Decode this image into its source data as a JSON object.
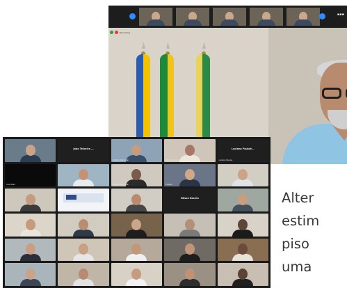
{
  "top_call": {
    "recording_label": "Recording",
    "strip_tile_captions": [
      "",
      "",
      "",
      "",
      ""
    ],
    "strip_more": "▪▪▪"
  },
  "gallery": {
    "tiles": [
      {
        "kind": "person",
        "bg": "#6a7c8a",
        "head": "#caa389",
        "torso": "#2c3e52",
        "caption": ""
      },
      {
        "kind": "name",
        "bg": "#1f1f1f",
        "name": "João Teixeira ...",
        "caption": ""
      },
      {
        "kind": "person",
        "bg": "#8fa3b6",
        "head": "#c79b7e",
        "torso": "#3a4f6b",
        "caption": "Prefeito Municipal"
      },
      {
        "kind": "person",
        "bg": "#cfc6b9",
        "head": "#a8776a",
        "torso": "#ede6dc",
        "caption": "Eliane Barbosa"
      },
      {
        "kind": "name",
        "bg": "#1f1f1f",
        "name": "Luciana Pauloé...",
        "caption": "Luciana Pauloé"
      },
      {
        "kind": "blank",
        "bg": "#0a0a0a",
        "caption": "Ana Paula"
      },
      {
        "kind": "person",
        "bg": "#9fb5c4",
        "head": "#c49376",
        "torso": "#e7ecef",
        "caption": ""
      },
      {
        "kind": "person",
        "bg": "#cfc9c0",
        "head": "#7a5a4a",
        "torso": "#2a2a2a",
        "caption": "Prefeita Municipal"
      },
      {
        "kind": "person",
        "bg": "#6a7587",
        "head": "#d0a887",
        "torso": "#2a3447",
        "caption": "Prefeito"
      },
      {
        "kind": "person",
        "bg": "#d3cec4",
        "head": "#caa389",
        "torso": "#dfe3e8",
        "caption": ""
      },
      {
        "kind": "person",
        "bg": "#cec8bc",
        "head": "#c49b7e",
        "torso": "#3b3b3b",
        "caption": ""
      },
      {
        "kind": "banner",
        "bg": "#f2f4f7",
        "caption": ""
      },
      {
        "kind": "person",
        "bg": "#d1ccc4",
        "head": "#bb8a6d",
        "torso": "#474747",
        "caption": ""
      },
      {
        "kind": "name",
        "bg": "#1f1f1f",
        "name": "Nilson Bacelo",
        "caption": ""
      },
      {
        "kind": "person",
        "bg": "#9fa8a0",
        "head": "#c99d80",
        "torso": "#44505b",
        "caption": ""
      },
      {
        "kind": "person",
        "bg": "#dcd5c9",
        "head": "#c89a7d",
        "torso": "#e8e4de",
        "caption": ""
      },
      {
        "kind": "person",
        "bg": "#d2cbbf",
        "head": "#b88d73",
        "torso": "#2f3a48",
        "caption": ""
      },
      {
        "kind": "person",
        "bg": "#77624b",
        "head": "#c9a58a",
        "torso": "#1e1e1e",
        "caption": ""
      },
      {
        "kind": "person",
        "bg": "#c5bfb6",
        "head": "#b59078",
        "torso": "#7a7a7a",
        "caption": ""
      },
      {
        "kind": "person",
        "bg": "#d8d2c8",
        "head": "#5e4637",
        "torso": "#1b1b1b",
        "caption": ""
      },
      {
        "kind": "person",
        "bg": "#b2b9bd",
        "head": "#c99e82",
        "torso": "#2a2f3a",
        "caption": ""
      },
      {
        "kind": "person",
        "bg": "#cfc6b8",
        "head": "#caa085",
        "torso": "#e6e6e6",
        "caption": ""
      },
      {
        "kind": "person",
        "bg": "#b4a99a",
        "head": "#c39879",
        "torso": "#f0f0f0",
        "caption": ""
      },
      {
        "kind": "person",
        "bg": "#6f6a63",
        "head": "#c09478",
        "torso": "#1d1d1d",
        "caption": ""
      },
      {
        "kind": "person",
        "bg": "#8a6e52",
        "head": "#6b4b3c",
        "torso": "#e9e2d8",
        "caption": ""
      },
      {
        "kind": "person",
        "bg": "#a9b4bb",
        "head": "#caa389",
        "torso": "#3b4657",
        "caption": ""
      },
      {
        "kind": "person",
        "bg": "#bfb6a8",
        "head": "#b68b70",
        "torso": "#e2e2e2",
        "caption": ""
      },
      {
        "kind": "person",
        "bg": "#d7d1c6",
        "head": "#c69b7f",
        "torso": "#f2f2f2",
        "caption": ""
      },
      {
        "kind": "person",
        "bg": "#9a9184",
        "head": "#c09175",
        "torso": "#2d2d2d",
        "caption": ""
      },
      {
        "kind": "person",
        "bg": "#c8bfb2",
        "head": "#5a4334",
        "torso": "#1f1f1f",
        "caption": ""
      }
    ]
  },
  "article": {
    "lines": [
      "Alter",
      "estim",
      "piso",
      "uma"
    ]
  }
}
